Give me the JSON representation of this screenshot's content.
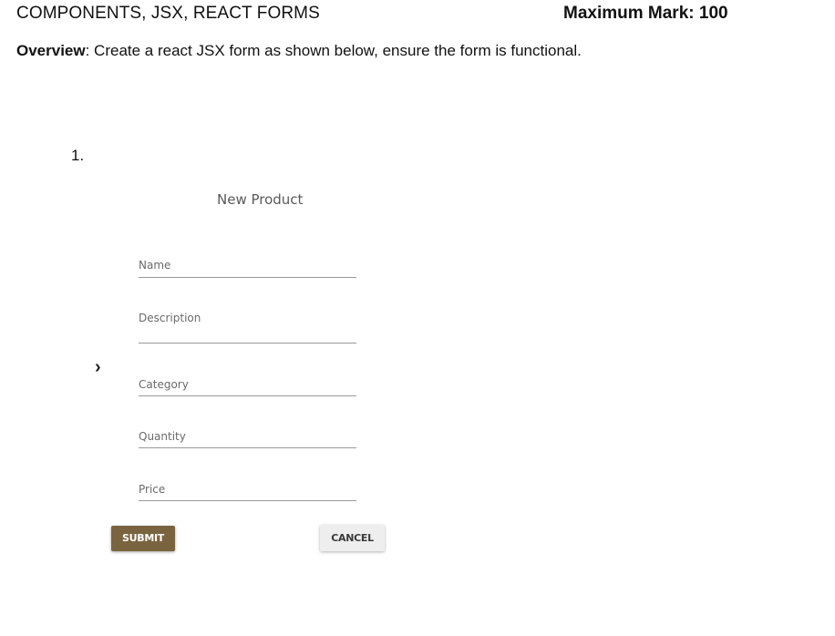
{
  "header": {
    "title": "COMPONENTS, JSX, REACT FORMS",
    "max_mark": "Maximum Mark: 100"
  },
  "overview": {
    "label": "Overview",
    "text": ": Create a react JSX form as shown below, ensure the form is functional."
  },
  "item_number": "1.",
  "side_mark": "›",
  "form": {
    "title": "New Product",
    "fields": [
      {
        "label": "Name"
      },
      {
        "label": "Description"
      },
      {
        "label": "Category"
      },
      {
        "label": "Quantity"
      },
      {
        "label": "Price"
      }
    ],
    "submit_label": "SUBMIT",
    "cancel_label": "CANCEL",
    "colors": {
      "submit_bg": "#7a6440",
      "cancel_bg": "#eeeeee"
    }
  }
}
